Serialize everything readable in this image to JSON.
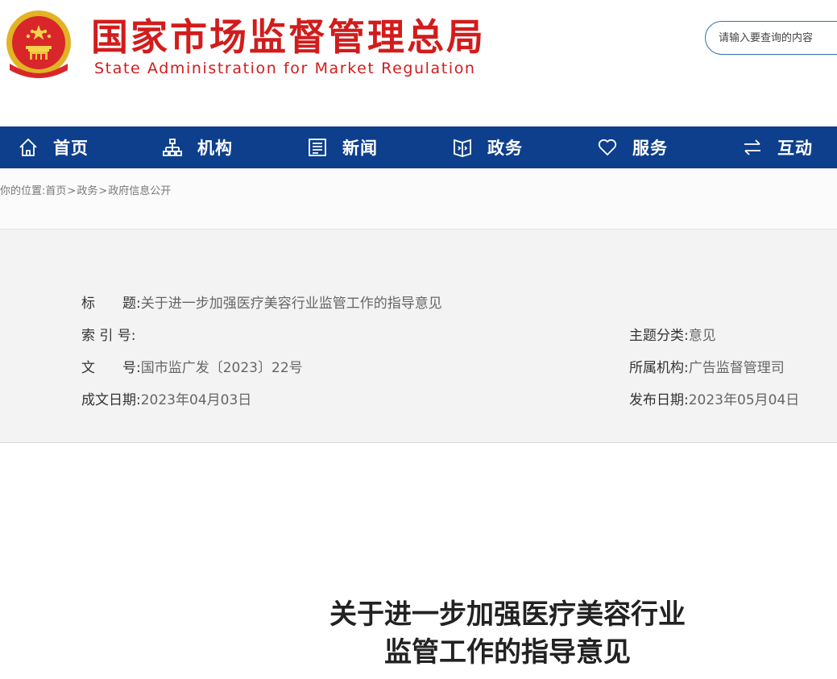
{
  "header": {
    "logo_cn": "国家市场监督管理总局",
    "logo_en": "State Administration for Market Regulation",
    "search_placeholder": "请输入要查询的内容"
  },
  "nav": {
    "items": [
      {
        "label": "首页",
        "icon": "home-icon"
      },
      {
        "label": "机构",
        "icon": "org-chart-icon"
      },
      {
        "label": "新闻",
        "icon": "news-icon"
      },
      {
        "label": "政务",
        "icon": "government-affairs-icon"
      },
      {
        "label": "服务",
        "icon": "heart-icon"
      },
      {
        "label": "互动",
        "icon": "exchange-icon"
      }
    ]
  },
  "breadcrumb": {
    "prefix": "你的位置:",
    "items": [
      "首页",
      "政务",
      "政府信息公开"
    ],
    "separator": ">"
  },
  "meta": {
    "title_label": "标　　题:",
    "title_value": "关于进一步加强医疗美容行业监管工作的指导意见",
    "index_label": "索 引 号:",
    "index_value": "",
    "topic_label": "主题分类:",
    "topic_value": "意见",
    "docno_label": "文　　号:",
    "docno_value": "国市监广发〔2023〕22号",
    "org_label": "所属机构:",
    "org_value": "广告监督管理司",
    "created_label": "成文日期:",
    "created_value": "2023年04月03日",
    "published_label": "发布日期:",
    "published_value": "2023年05月04日"
  },
  "article": {
    "title_line1": "关于进一步加强医疗美容行业",
    "title_line2": "监管工作的指导意见"
  },
  "colors": {
    "brand_red": "#d21c1c",
    "nav_blue": "#0e3f8d"
  }
}
